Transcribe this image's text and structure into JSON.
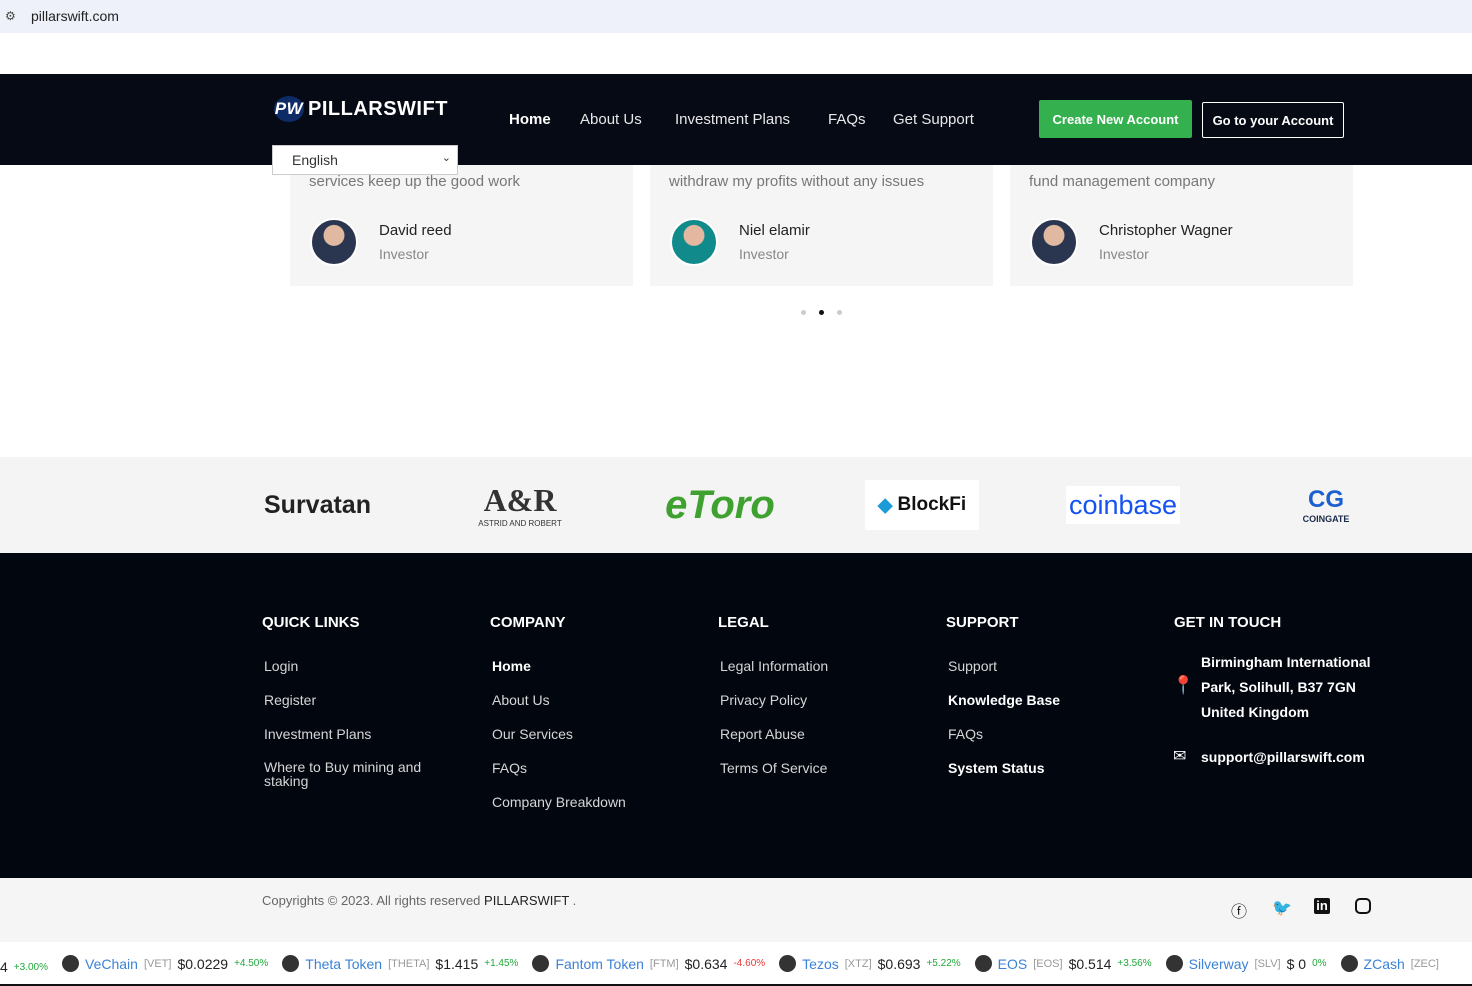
{
  "browser": {
    "url": "pillarswift.com"
  },
  "nav": {
    "brand": "PILLARSWIFT",
    "brand_mark": "PW",
    "links": [
      "Home",
      "About Us",
      "Investment Plans",
      "FAQs",
      "Get Support"
    ],
    "create_account": "Create New Account",
    "go_account": "Go to your Account",
    "language": "English"
  },
  "testimonials": [
    {
      "quote": "services keep up the good work",
      "name": "David reed",
      "role": "Investor"
    },
    {
      "quote": "withdraw my profits without any issues",
      "name": "Niel elamir",
      "role": "Investor"
    },
    {
      "quote": "fund management company",
      "name": "Christopher Wagner",
      "role": "Investor"
    }
  ],
  "partners": [
    "Survatan",
    "A&R",
    "ASTRID AND ROBERT",
    "eToro",
    "BlockFi",
    "coinbase",
    "COINGATE"
  ],
  "footer": {
    "quick_links": {
      "title": "QUICK LINKS",
      "items": [
        "Login",
        "Register",
        "Investment Plans",
        "Where to Buy mining and staking"
      ]
    },
    "company": {
      "title": "COMPANY",
      "items": [
        "Home",
        "About Us",
        "Our Services",
        "FAQs",
        "Company Breakdown"
      ]
    },
    "legal": {
      "title": "LEGAL",
      "items": [
        "Legal Information",
        "Privacy Policy",
        "Report Abuse",
        "Terms Of Service"
      ]
    },
    "support": {
      "title": "SUPPORT",
      "items": [
        "Support",
        "Knowledge Base",
        "FAQs",
        "System Status"
      ]
    },
    "contact": {
      "title": "GET IN TOUCH",
      "address": [
        "Birmingham International",
        "Park, Solihull, B37 7GN",
        "United Kingdom"
      ],
      "email": "support@pillarswift.com"
    }
  },
  "copyright": {
    "text": "Copyrights © 2023. All rights reserved",
    "brand": "PILLARSWIFT",
    "end": "."
  },
  "ticker": [
    {
      "name": "",
      "symbol": "",
      "price": "4",
      "change": "+3.00%",
      "dir": "up"
    },
    {
      "name": "VeChain",
      "symbol": "[VET]",
      "price": "$0.0229",
      "change": "+4.50%",
      "dir": "up"
    },
    {
      "name": "Theta Token",
      "symbol": "[THETA]",
      "price": "$1.415",
      "change": "+1.45%",
      "dir": "up"
    },
    {
      "name": "Fantom Token",
      "symbol": "[FTM]",
      "price": "$0.634",
      "change": "-4.60%",
      "dir": "dn"
    },
    {
      "name": "Tezos",
      "symbol": "[XTZ]",
      "price": "$0.693",
      "change": "+5.22%",
      "dir": "up"
    },
    {
      "name": "EOS",
      "symbol": "[EOS]",
      "price": "$0.514",
      "change": "+3.56%",
      "dir": "up"
    },
    {
      "name": "Silverway",
      "symbol": "[SLV]",
      "price": "$ 0",
      "change": "0%",
      "dir": "up"
    },
    {
      "name": "ZCash",
      "symbol": "[ZEC]",
      "price": "",
      "change": "",
      "dir": "up"
    }
  ],
  "colors": {
    "nav_bg": "#060a14",
    "accent_green": "#34b04f",
    "footer_bg": "#02060f"
  }
}
